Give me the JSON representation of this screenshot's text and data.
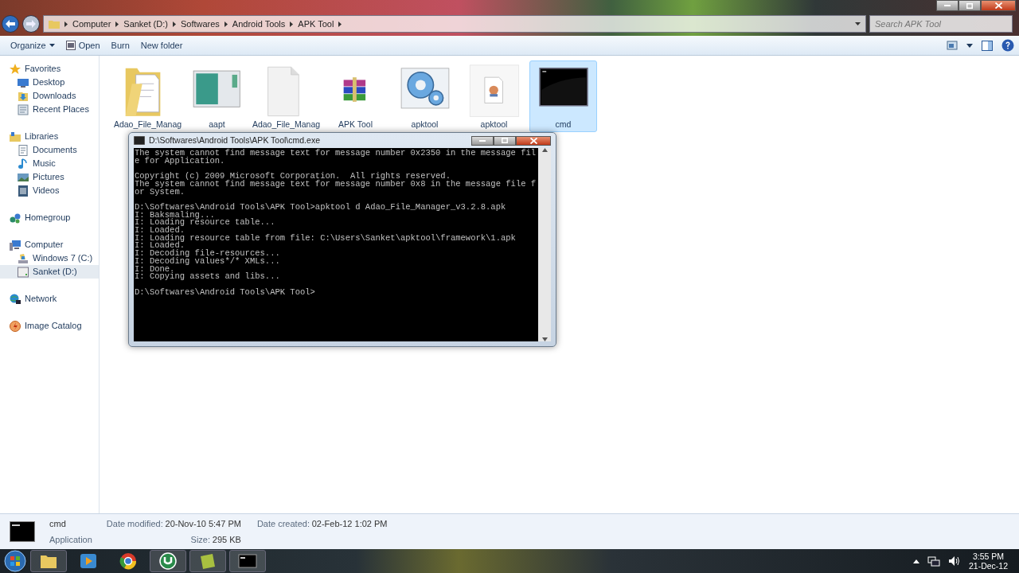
{
  "address_bar": {
    "crumbs": [
      "Computer",
      "Sanket (D:)",
      "Softwares",
      "Android Tools",
      "APK Tool"
    ]
  },
  "search": {
    "placeholder": "Search APK Tool"
  },
  "toolbar": {
    "buttons": [
      {
        "label": "Organize",
        "kind": "menu"
      },
      {
        "label": "Open",
        "kind": "icon"
      },
      {
        "label": "Burn",
        "kind": "plain"
      },
      {
        "label": "New folder",
        "kind": "plain"
      }
    ]
  },
  "sidebar": {
    "groups": [
      {
        "label": "Favorites",
        "kind": "star",
        "selected": false,
        "children": [
          {
            "label": "Desktop",
            "kind": "desktop",
            "selected": false
          },
          {
            "label": "Downloads",
            "kind": "downloads",
            "selected": false
          },
          {
            "label": "Recent Places",
            "kind": "recent",
            "selected": false
          }
        ]
      },
      {
        "label": "Libraries",
        "kind": "library",
        "selected": false,
        "children": [
          {
            "label": "Documents",
            "kind": "documents",
            "selected": false
          },
          {
            "label": "Music",
            "kind": "music",
            "selected": false
          },
          {
            "label": "Pictures",
            "kind": "pictures",
            "selected": false
          },
          {
            "label": "Videos",
            "kind": "videos",
            "selected": false
          }
        ]
      },
      {
        "label": "Homegroup",
        "kind": "homegroup",
        "selected": false
      },
      {
        "label": "Computer",
        "kind": "computer",
        "selected": false,
        "children": [
          {
            "label": "Windows 7 (C:)",
            "kind": "drive_c",
            "selected": false
          },
          {
            "label": "Sanket (D:)",
            "kind": "drive",
            "selected": true
          }
        ]
      },
      {
        "label": "Network",
        "kind": "network",
        "selected": false
      },
      {
        "label": "Image Catalog",
        "kind": "catalog",
        "selected": false
      }
    ]
  },
  "files": [
    {
      "label": "Adao_File_Manag",
      "kind": "folder",
      "selected": false
    },
    {
      "label": "aapt",
      "kind": "window",
      "selected": false
    },
    {
      "label": "Adao_File_Manag",
      "kind": "blank",
      "selected": false
    },
    {
      "label": "APK Tool",
      "kind": "archive",
      "selected": false
    },
    {
      "label": "apktool",
      "kind": "gears",
      "selected": false
    },
    {
      "label": "apktool",
      "kind": "jar",
      "selected": false
    },
    {
      "label": "cmd",
      "kind": "console",
      "selected": true
    }
  ],
  "console_window": {
    "title": "D:\\Softwares\\Android Tools\\APK Tool\\cmd.exe",
    "blocks": [
      [
        "The system cannot find message text for message number 0x2350 in the message fil",
        "e for Application."
      ],
      [
        "Copyright (c) 2009 Microsoft Corporation.  All rights reserved.",
        "The system cannot find message text for message number 0x8 in the message file f",
        "or System."
      ],
      [
        "D:\\Softwares\\Android Tools\\APK Tool>apktool d Adao_File_Manager_v3.2.8.apk",
        "I: Baksmaling...",
        "I: Loading resource table...",
        "I: Loaded.",
        "I: Loading resource table from file: C:\\Users\\Sanket\\apktool\\framework\\1.apk",
        "I: Loaded.",
        "I: Decoding file-resources...",
        "I: Decoding values*/* XMLs...",
        "I: Done.",
        "I: Copying assets and libs..."
      ],
      [
        "D:\\Softwares\\Android Tools\\APK Tool>"
      ]
    ]
  },
  "details": {
    "name": "cmd",
    "type": "Application",
    "fields": [
      {
        "label": "Date modified:",
        "value": "20-Nov-10 5:47 PM"
      },
      {
        "label": "Size:",
        "value": "295 KB"
      },
      {
        "label": "Date created:",
        "value": "02-Feb-12 1:02 PM"
      }
    ]
  },
  "taskbar": {
    "apps": [
      {
        "kind": "explorer",
        "selected": true
      },
      {
        "kind": "player",
        "selected": false
      },
      {
        "kind": "browser",
        "selected": false
      },
      {
        "kind": "torrent",
        "selected": true
      },
      {
        "kind": "notes",
        "selected": true
      },
      {
        "kind": "console",
        "selected": true
      }
    ],
    "time": "3:55 PM",
    "date": "21-Dec-12"
  }
}
